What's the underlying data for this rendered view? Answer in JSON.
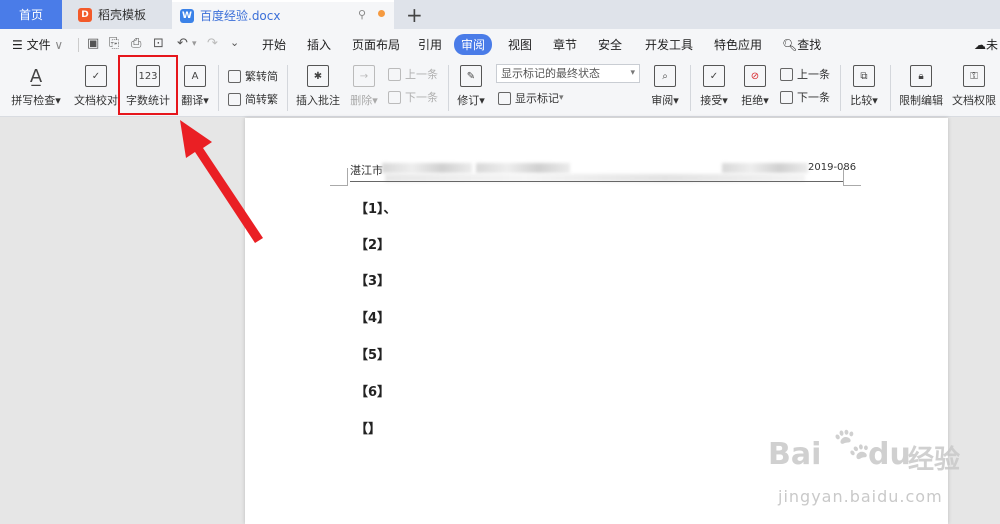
{
  "tabs": {
    "home": "首页",
    "daoke": "稻壳模板",
    "document": "百度经验.docx",
    "add": "+"
  },
  "menu": {
    "file": "文件",
    "items": [
      "开始",
      "插入",
      "页面布局",
      "引用",
      "审阅",
      "视图",
      "章节",
      "安全",
      "开发工具",
      "特色应用"
    ],
    "active": "审阅",
    "search": "查找",
    "right_cut": "未"
  },
  "ribbon": {
    "spell_check": "拼写检查",
    "doc_proof": "文档校对",
    "word_count": "字数统计",
    "translate": "翻译",
    "trad_to_simp": "繁转简",
    "simp_to_trad": "简转繁",
    "insert_comment": "插入批注",
    "delete": "删除",
    "prev_comment": "上一条",
    "next_comment": "下一条",
    "revise": "修订",
    "markup_state": "显示标记的最终状态",
    "show_markup": "显示标记",
    "review": "审阅",
    "accept": "接受",
    "reject": "拒绝",
    "prev_change": "上一条",
    "next_change": "下一条",
    "compare": "比较",
    "restrict_edit": "限制编辑",
    "doc_permission": "文档权限",
    "word_count_icon_text": "123"
  },
  "document": {
    "header_left": "湛江市",
    "header_right": "2019-086",
    "paragraphs": [
      "【1】、",
      "【2】",
      "【3】",
      "【4】",
      "【5】",
      "【6】",
      "【】"
    ]
  },
  "watermark": {
    "brand": "Bai",
    "brand2": "du",
    "brand_cn": "经验",
    "url": "jingyan.baidu.com"
  },
  "colors": {
    "accent": "#4a7ce8",
    "highlight": "#e6161c"
  }
}
